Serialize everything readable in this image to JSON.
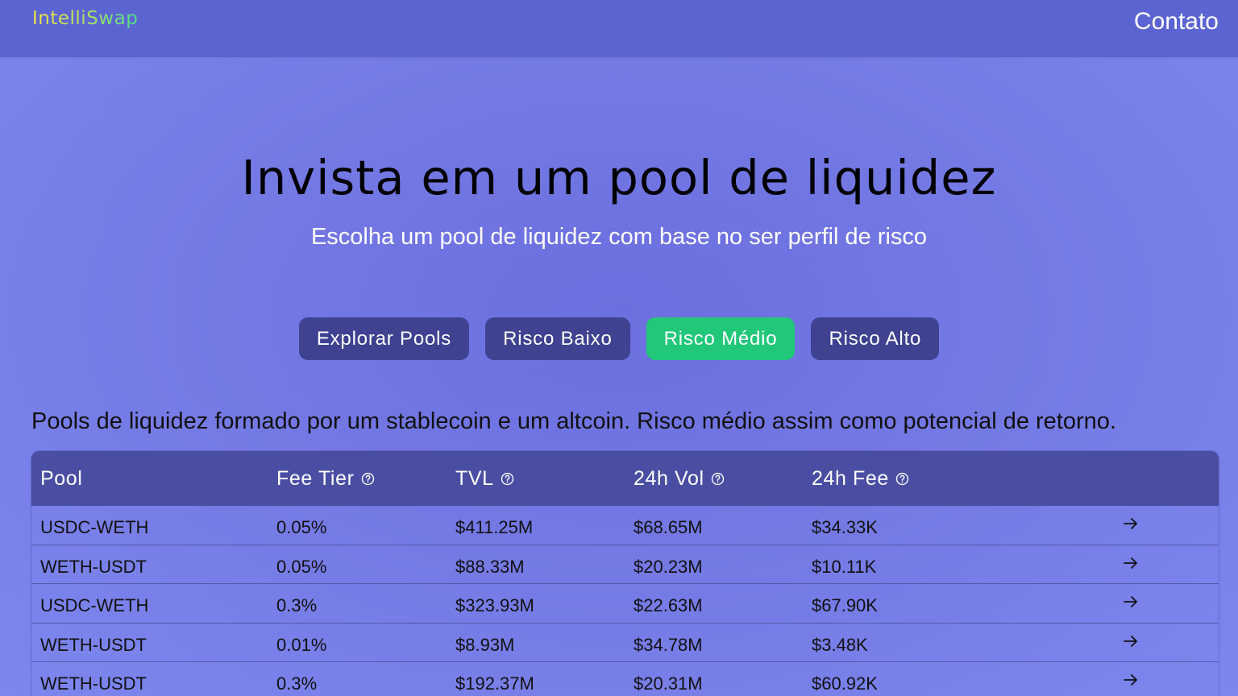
{
  "header": {
    "logo": "IntelliSwap",
    "contact_label": "Contato"
  },
  "hero": {
    "title": "Invista em um pool de liquidez",
    "subtitle": "Escolha um pool de liquidez com base no ser perfil de risco"
  },
  "filters": [
    {
      "label": "Explorar Pools",
      "active": false
    },
    {
      "label": "Risco Baixo",
      "active": false
    },
    {
      "label": "Risco Médio",
      "active": true
    },
    {
      "label": "Risco Alto",
      "active": false
    }
  ],
  "colors": {
    "active_filter": "#21c87a",
    "filter": "#3e4291",
    "header": "#5c64d2",
    "table_header": "#4a4ea3"
  },
  "description": "Pools de liquidez formado por um stablecoin e um altcoin. Risco médio assim como potencial de retorno.",
  "table": {
    "headers": {
      "pool": "Pool",
      "fee_tier": "Fee Tier",
      "tvl": "TVL",
      "vol_24h": "24h Vol",
      "fee_24h": "24h Fee"
    },
    "header_icons": "help-circle-icon",
    "row_icon": "arrow-right-icon",
    "rows": [
      {
        "pool": "USDC-WETH",
        "fee_tier": "0.05%",
        "tvl": "$411.25M",
        "vol_24h": "$68.65M",
        "fee_24h": "$34.33K"
      },
      {
        "pool": "WETH-USDT",
        "fee_tier": "0.05%",
        "tvl": "$88.33M",
        "vol_24h": "$20.23M",
        "fee_24h": "$10.11K"
      },
      {
        "pool": "USDC-WETH",
        "fee_tier": "0.3%",
        "tvl": "$323.93M",
        "vol_24h": "$22.63M",
        "fee_24h": "$67.90K"
      },
      {
        "pool": "WETH-USDT",
        "fee_tier": "0.01%",
        "tvl": "$8.93M",
        "vol_24h": "$34.78M",
        "fee_24h": "$3.48K"
      },
      {
        "pool": "WETH-USDT",
        "fee_tier": "0.3%",
        "tvl": "$192.37M",
        "vol_24h": "$20.31M",
        "fee_24h": "$60.92K"
      }
    ]
  }
}
